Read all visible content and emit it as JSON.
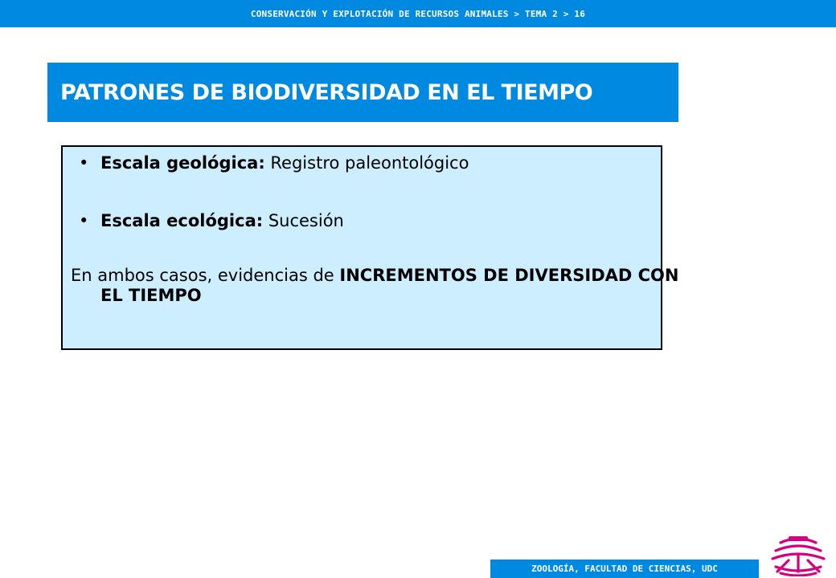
{
  "header": {
    "breadcrumb": "CONSERVACIÓN Y EXPLOTACIÓN DE RECURSOS ANIMALES > TEMA 2 > 16"
  },
  "slide": {
    "title": "PATRONES DE BIODIVERSIDAD EN EL TIEMPO",
    "bullets": [
      {
        "term": "Escala geológica:",
        "text": " Registro paleontológico"
      },
      {
        "term": "Escala ecológica:",
        "text": " Sucesión"
      }
    ],
    "bullet_symbol": "•",
    "conclusion": {
      "prefix": "En ambos casos, evidencias de ",
      "emphasis": "INCREMENTOS DE DIVERSIDAD CON EL TIEMPO"
    }
  },
  "footer": {
    "text": "ZOOLOGÍA, FACULTAD DE CIENCIAS, UDC",
    "logo_icon": "udc-university-logo-icon"
  },
  "colors": {
    "accent_blue": "#0089e0",
    "content_bg": "#cdeeff",
    "logo_magenta": "#d6007e"
  }
}
